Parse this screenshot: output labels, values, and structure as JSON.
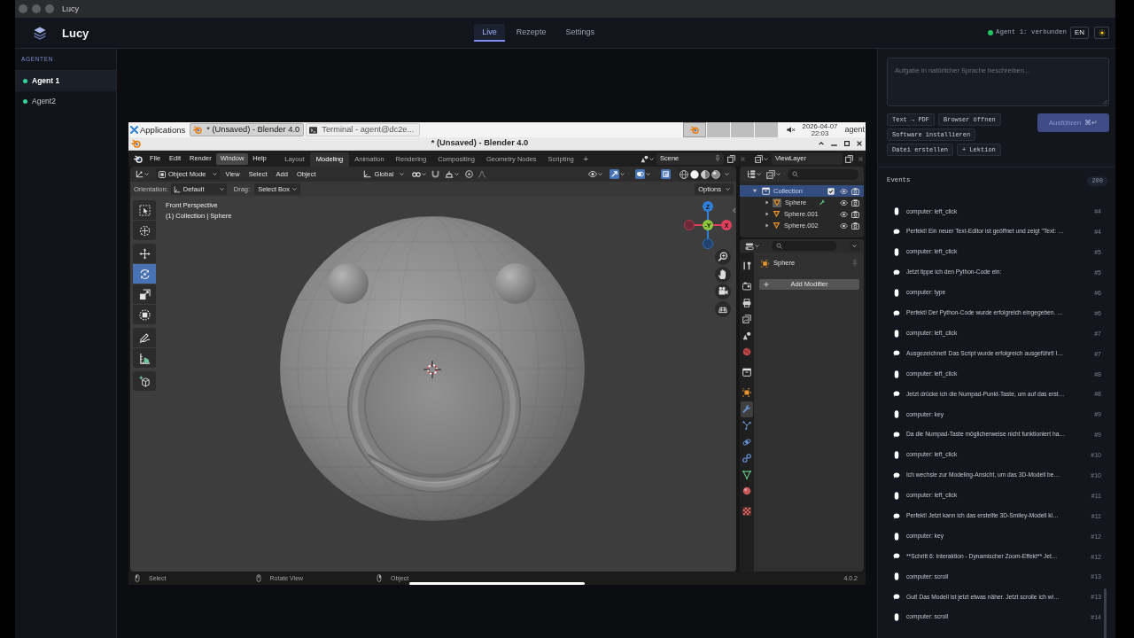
{
  "window": {
    "title": "Lucy"
  },
  "header": {
    "app_name": "Lucy",
    "tabs": [
      {
        "label": "Live",
        "selected": true
      },
      {
        "label": "Rezepte",
        "selected": false
      },
      {
        "label": "Settings",
        "selected": false
      }
    ],
    "connection": {
      "label": "Agent 1: verbunden",
      "connected": true
    },
    "language": "EN"
  },
  "sidebar": {
    "heading": "AGENTEN",
    "agents": [
      {
        "name": "Agent 1",
        "selected": true,
        "online": true
      },
      {
        "name": "Agent2",
        "selected": false,
        "online": true
      }
    ]
  },
  "remote_screen": {
    "panel": {
      "menu": "Applications",
      "tasks": [
        {
          "kind": "blender",
          "title": "* (Unsaved) - Blender 4.0",
          "selected": true
        },
        {
          "kind": "terminal",
          "title": "Terminal - agent@dc2e...",
          "selected": false
        }
      ],
      "workspaces": [
        {
          "kind": "blender",
          "selected": true
        },
        {
          "kind": "empty",
          "selected": false
        },
        {
          "kind": "empty",
          "selected": false
        },
        {
          "kind": "empty",
          "selected": false
        }
      ],
      "muted": true,
      "date": "2026-04-07",
      "time": "22:03",
      "user": "agent"
    },
    "window_title": "* (Unsaved) - Blender 4.0",
    "blender": {
      "menus": [
        {
          "label": "File",
          "highlighted": false
        },
        {
          "label": "Edit",
          "highlighted": false
        },
        {
          "label": "Render",
          "highlighted": false
        },
        {
          "label": "Window",
          "highlighted": true
        },
        {
          "label": "Help",
          "highlighted": false
        }
      ],
      "workspaces": [
        {
          "label": "Layout",
          "selected": false
        },
        {
          "label": "Modeling",
          "selected": true
        },
        {
          "label": "Animation",
          "selected": false
        },
        {
          "label": "Rendering",
          "selected": false
        },
        {
          "label": "Compositing",
          "selected": false
        },
        {
          "label": "Geometry Nodes",
          "selected": false
        },
        {
          "label": "Scripting",
          "selected": false
        }
      ],
      "add_workspace": "+",
      "scene": "Scene",
      "view_layer": "ViewLayer",
      "viewport_header": {
        "mode": "Object Mode",
        "menus": [
          "View",
          "Select",
          "Add",
          "Object"
        ],
        "orientation": "Global"
      },
      "tool_settings": {
        "orientation_label": "Orientation:",
        "orientation": "Default",
        "drag_label": "Drag:",
        "drag": "Select Box",
        "options": "Options"
      },
      "viewport": {
        "view_name": "Front Perspective",
        "context": "(1) Collection | Sphere",
        "tool_groups": [
          [
            {
              "kind": "select_box",
              "selected": false
            },
            {
              "kind": "cursor",
              "selected": false
            }
          ],
          [
            {
              "kind": "move",
              "selected": false
            },
            {
              "kind": "rotate",
              "selected": true
            },
            {
              "kind": "scale",
              "selected": false
            },
            {
              "kind": "transform",
              "selected": false
            }
          ],
          [
            {
              "kind": "annotate",
              "selected": false
            },
            {
              "kind": "measure",
              "selected": false
            }
          ],
          [
            {
              "kind": "add_cube",
              "selected": false
            }
          ]
        ],
        "gizmo": {
          "z_label": "Z",
          "y_label": "-Y",
          "x_label": "X"
        }
      },
      "outliner": {
        "items": [
          {
            "kind": "collection",
            "name": "Collection",
            "selected": true,
            "expanded": true,
            "checked": true,
            "children": [
              {
                "kind": "mesh",
                "name": "Sphere",
                "selected": false,
                "expanded": false,
                "active": true,
                "has_modifier": true
              },
              {
                "kind": "mesh",
                "name": "Sphere.001",
                "selected": false,
                "expanded": false,
                "active": false,
                "has_modifier": false
              },
              {
                "kind": "mesh",
                "name": "Sphere.002",
                "selected": false,
                "expanded": false,
                "active": false,
                "has_modifier": false
              }
            ]
          }
        ]
      },
      "properties": {
        "tab_groups": [
          [
            {
              "kind": "tool",
              "selected": false
            }
          ],
          [
            {
              "kind": "render",
              "selected": false
            },
            {
              "kind": "output",
              "selected": false
            },
            {
              "kind": "view_layer",
              "selected": false
            },
            {
              "kind": "scene",
              "selected": false
            },
            {
              "kind": "world",
              "selected": false
            }
          ],
          [
            {
              "kind": "collection",
              "selected": false
            }
          ],
          [
            {
              "kind": "object",
              "selected": false
            },
            {
              "kind": "modifiers",
              "selected": true
            },
            {
              "kind": "particles",
              "selected": false
            },
            {
              "kind": "physics",
              "selected": false
            },
            {
              "kind": "constraints",
              "selected": false
            },
            {
              "kind": "data",
              "selected": false
            },
            {
              "kind": "material",
              "selected": false
            }
          ],
          [
            {
              "kind": "texture",
              "selected": false
            }
          ]
        ],
        "object": "Sphere",
        "add_modifier": "Add Modifier"
      },
      "status_bar": {
        "hints": [
          {
            "kind": "left",
            "label": "Select"
          },
          {
            "kind": "middle",
            "label": "Rotate View"
          },
          {
            "kind": "right",
            "label": "Object"
          }
        ],
        "version": "4.0.2"
      }
    }
  },
  "task_panel": {
    "placeholder": "Aufgabe in natürlicher Sprache beschreiben...",
    "quick_actions": [
      "Text → PDF",
      "Browser öffnen",
      "Software installieren",
      "Datei erstellen",
      "+ Lektion"
    ],
    "run_button": {
      "label": "Ausführen",
      "shortcut": "⌘↵",
      "disabled": true
    }
  },
  "events": {
    "title": "Events",
    "count": "200",
    "items": [
      {
        "kind": "action",
        "text": "computer: left_click",
        "step": "#4"
      },
      {
        "kind": "message",
        "text": "Perfekt! Ein neuer Text-Editor ist geöffnet und zeigt \"Text: …",
        "step": "#4"
      },
      {
        "kind": "action",
        "text": "computer: left_click",
        "step": "#5"
      },
      {
        "kind": "message",
        "text": "Jetzt tippe ich den Python-Code ein:",
        "step": "#5"
      },
      {
        "kind": "action",
        "text": "computer: type",
        "step": "#6"
      },
      {
        "kind": "message",
        "text": "Perfekt! Der Python-Code wurde erfolgreich eingegeben. …",
        "step": "#6"
      },
      {
        "kind": "action",
        "text": "computer: left_click",
        "step": "#7"
      },
      {
        "kind": "message",
        "text": "Ausgezeichnet! Das Script wurde erfolgreich ausgeführt! I…",
        "step": "#7"
      },
      {
        "kind": "action",
        "text": "computer: left_click",
        "step": "#8"
      },
      {
        "kind": "message",
        "text": "Jetzt drücke ich die Numpad-Punkt-Taste, um auf das erst…",
        "step": "#8"
      },
      {
        "kind": "action",
        "text": "computer: key",
        "step": "#9"
      },
      {
        "kind": "message",
        "text": "Da die Numpad-Taste möglicherweise nicht funktioniert ha…",
        "step": "#9"
      },
      {
        "kind": "action",
        "text": "computer: left_click",
        "step": "#10"
      },
      {
        "kind": "message",
        "text": "Ich wechsle zur Modeling-Ansicht, um das 3D-Modell be…",
        "step": "#10"
      },
      {
        "kind": "action",
        "text": "computer: left_click",
        "step": "#11"
      },
      {
        "kind": "message",
        "text": "Perfekt! Jetzt kann ich das erstellte 3D-Smiley-Modell kl…",
        "step": "#11"
      },
      {
        "kind": "action",
        "text": "computer: key",
        "step": "#12"
      },
      {
        "kind": "message",
        "text": "**Schritt 6: Interaktion - Dynamischer Zoom-Effekt** Jet…",
        "step": "#12"
      },
      {
        "kind": "action",
        "text": "computer: scroll",
        "step": "#13"
      },
      {
        "kind": "message",
        "text": "Gut! Das Modell ist jetzt etwas näher. Jetzt scrolle ich wi…",
        "step": "#13"
      },
      {
        "kind": "action",
        "text": "computer: scroll",
        "step": "#14"
      }
    ]
  }
}
